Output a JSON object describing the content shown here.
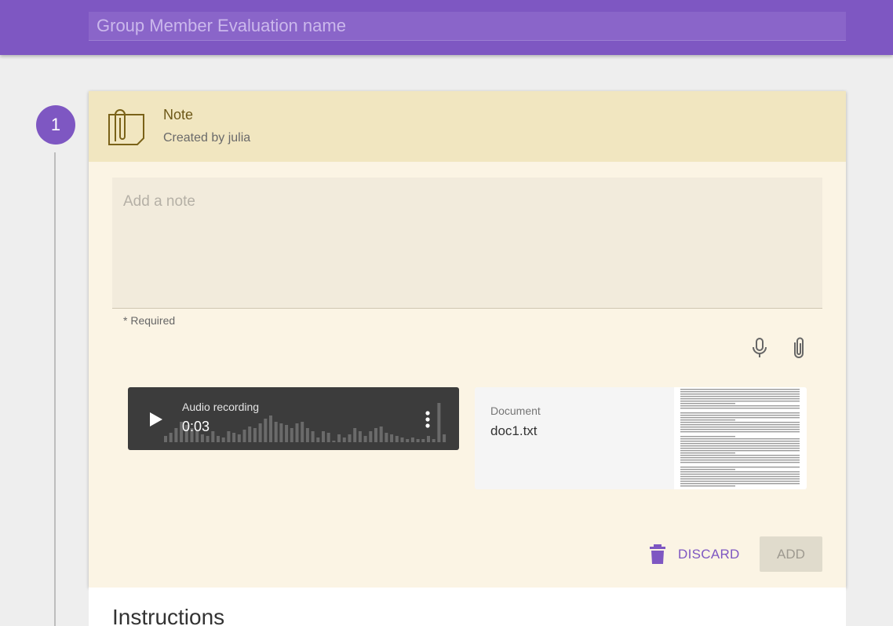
{
  "header": {
    "name_placeholder": "Group Member Evaluation name"
  },
  "step": {
    "number": "1"
  },
  "note": {
    "title": "Note",
    "created_by": "Created by julia",
    "placeholder": "Add a note",
    "required": "* Required"
  },
  "audio": {
    "title": "Audio recording",
    "duration": "0:03"
  },
  "document": {
    "label": "Document",
    "filename": "doc1.txt"
  },
  "actions": {
    "discard": "DISCARD",
    "add": "ADD"
  },
  "instructions": {
    "title": "Instructions"
  },
  "colors": {
    "accent": "#7e57c2",
    "card_bg": "#fbf4e4",
    "header_bg": "#f1e6c0"
  }
}
